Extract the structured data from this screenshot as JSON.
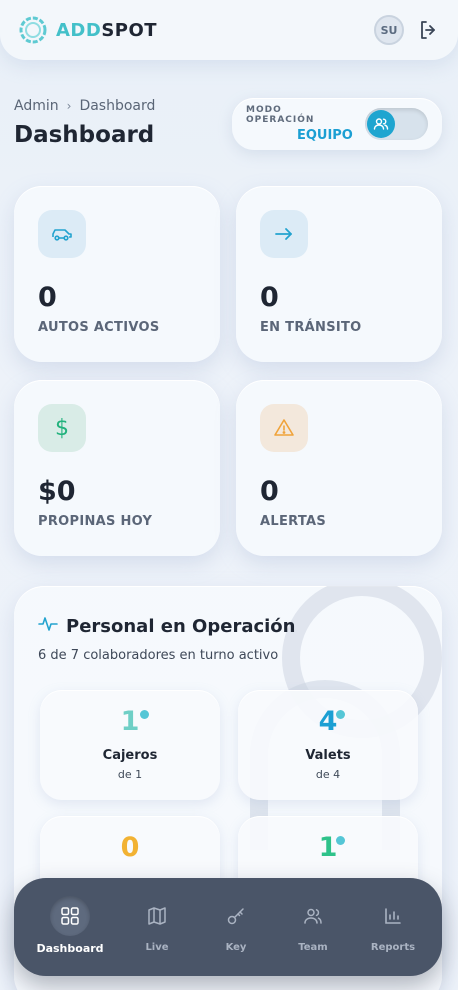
{
  "header": {
    "logo_part1": "ADD",
    "logo_part2": "SPOT",
    "avatar_initials": "SU"
  },
  "breadcrumb": {
    "parent": "Admin",
    "separator": "›",
    "current": "Dashboard"
  },
  "page_title": "Dashboard",
  "mode": {
    "label": "MODO OPERACIÓN",
    "value": "EQUIPO"
  },
  "stats": [
    {
      "value": "0",
      "label": "AUTOS ACTIVOS",
      "icon": "car-icon"
    },
    {
      "value": "0",
      "label": "EN TRÁNSITO",
      "icon": "arrow-right-icon"
    },
    {
      "value": "$0",
      "label": "PROPINAS HOY",
      "icon": "dollar-icon",
      "icon_glyph": "$"
    },
    {
      "value": "0",
      "label": "ALERTAS",
      "icon": "warning-icon"
    }
  ],
  "personal": {
    "title": "Personal en Operación",
    "subtitle": "6 de 7 colaboradores en turno activo",
    "roles": [
      {
        "count": "1",
        "name": "Cajeros",
        "of": "de 1",
        "color": "#6fcfc6"
      },
      {
        "count": "4",
        "name": "Valets",
        "of": "de 4",
        "color": "#1b9fd3"
      },
      {
        "count": "0",
        "name": "",
        "of": "",
        "color": "#f2b233"
      },
      {
        "count": "1",
        "name": "",
        "of": "",
        "color": "#2ec28a"
      }
    ]
  },
  "nav": [
    {
      "label": "Dashboard",
      "icon": "grid-icon",
      "active": true
    },
    {
      "label": "Live",
      "icon": "map-icon",
      "active": false
    },
    {
      "label": "Key",
      "icon": "key-icon",
      "active": false
    },
    {
      "label": "Team",
      "icon": "users-icon",
      "active": false
    },
    {
      "label": "Reports",
      "icon": "bar-chart-icon",
      "active": false
    }
  ],
  "colors": {
    "accent": "#1b9fd3",
    "teal": "#43c0c9",
    "nav_bg": "#4a5568",
    "warning": "#f0a33a",
    "success": "#2ec28a"
  }
}
